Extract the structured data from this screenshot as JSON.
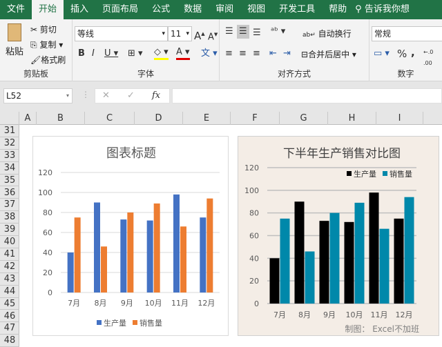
{
  "tabs": [
    "文件",
    "开始",
    "插入",
    "页面布局",
    "公式",
    "数据",
    "审阅",
    "视图",
    "开发工具",
    "帮助"
  ],
  "search_hint": "告诉我你想",
  "ribbon": {
    "paste": "粘贴",
    "cut": "剪切",
    "copy": "复制",
    "format_painter": "格式刷",
    "clipboard": "剪贴板",
    "font_name": "等线",
    "font_size": "11",
    "font_group": "字体",
    "wrap_text": "自动换行",
    "merge_center": "合并后居中",
    "alignment_group": "对齐方式",
    "number_format": "常规",
    "number_group": "数字"
  },
  "formula_bar": {
    "name_box": "L52",
    "formula": ""
  },
  "columns": [
    "A",
    "B",
    "C",
    "D",
    "E",
    "F",
    "G",
    "H",
    "I"
  ],
  "rows": [
    "31",
    "32",
    "33",
    "34",
    "35",
    "36",
    "37",
    "38",
    "39",
    "40",
    "41",
    "42",
    "43",
    "44",
    "45",
    "46",
    "47",
    "48"
  ],
  "chart_data": [
    {
      "type": "bar",
      "title": "图表标题",
      "categories": [
        "7月",
        "8月",
        "9月",
        "10月",
        "11月",
        "12月"
      ],
      "series": [
        {
          "name": "生产量",
          "values": [
            40,
            90,
            73,
            72,
            98,
            75
          ],
          "color": "#4472c4"
        },
        {
          "name": "销售量",
          "values": [
            75,
            46,
            80,
            89,
            66,
            94
          ],
          "color": "#ed7d31"
        }
      ],
      "ylim": [
        0,
        120
      ],
      "yticks": [
        "0",
        "20",
        "40",
        "60",
        "80",
        "100",
        "120"
      ],
      "legend": "bottom",
      "grid": true
    },
    {
      "type": "bar",
      "title": "下半年生产销售对比图",
      "categories": [
        "7月",
        "8月",
        "9月",
        "10月",
        "11月",
        "12月"
      ],
      "series": [
        {
          "name": "生产量",
          "values": [
            40,
            90,
            73,
            72,
            98,
            75
          ],
          "color": "#000000"
        },
        {
          "name": "销售量",
          "values": [
            75,
            46,
            80,
            89,
            66,
            94
          ],
          "color": "#0088aa"
        }
      ],
      "ylim": [
        0,
        120
      ],
      "yticks": [
        "0",
        "20",
        "40",
        "60",
        "80",
        "100",
        "120"
      ],
      "legend": "top-right",
      "grid": true,
      "footnote": "制图：  Excel不加班"
    }
  ]
}
